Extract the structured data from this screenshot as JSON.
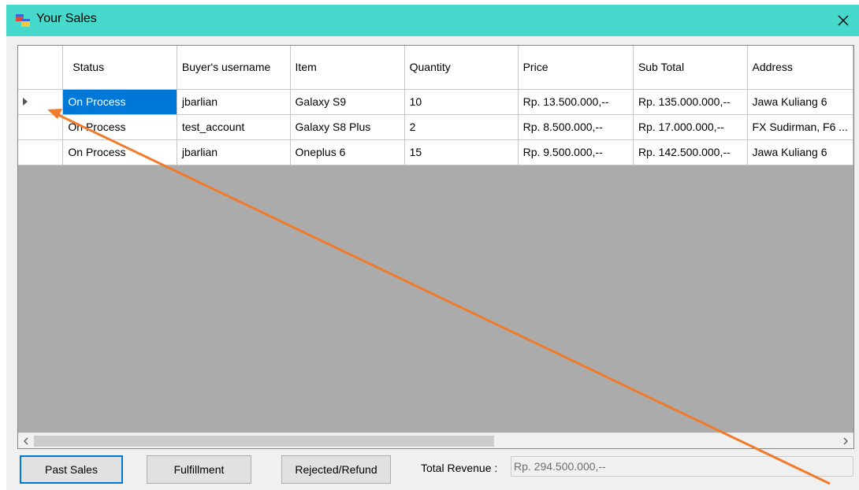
{
  "window": {
    "title": "Your Sales",
    "accent_color": "#46d9cb"
  },
  "grid": {
    "columns": [
      "Status",
      "Buyer's username",
      "Item",
      "Quantity",
      "Price",
      "Sub Total",
      "Address"
    ],
    "rows": [
      [
        "On Process",
        "jbarlian",
        "Galaxy S9",
        "10",
        "Rp. 13.500.000,--",
        "Rp. 135.000.000,--",
        "Jawa Kuliang 6"
      ],
      [
        "On Process",
        "test_account",
        "Galaxy S8 Plus",
        "2",
        "Rp. 8.500.000,--",
        "Rp. 17.000.000,--",
        "FX Sudirman, F6 ..."
      ],
      [
        "On Process",
        "jbarlian",
        "Oneplus 6",
        "15",
        "Rp. 9.500.000,--",
        "Rp. 142.500.000,--",
        "Jawa Kuliang 6"
      ]
    ],
    "selection_color": "#0078d7"
  },
  "buttons": {
    "past_sales": "Past Sales",
    "fulfillment": "Fulfillment",
    "rejected_refund": "Rejected/Refund"
  },
  "revenue": {
    "label": "Total Revenue :",
    "value": "Rp. 294.500.000,--"
  },
  "annotation": {
    "arrow_color": "#f07b2b"
  }
}
